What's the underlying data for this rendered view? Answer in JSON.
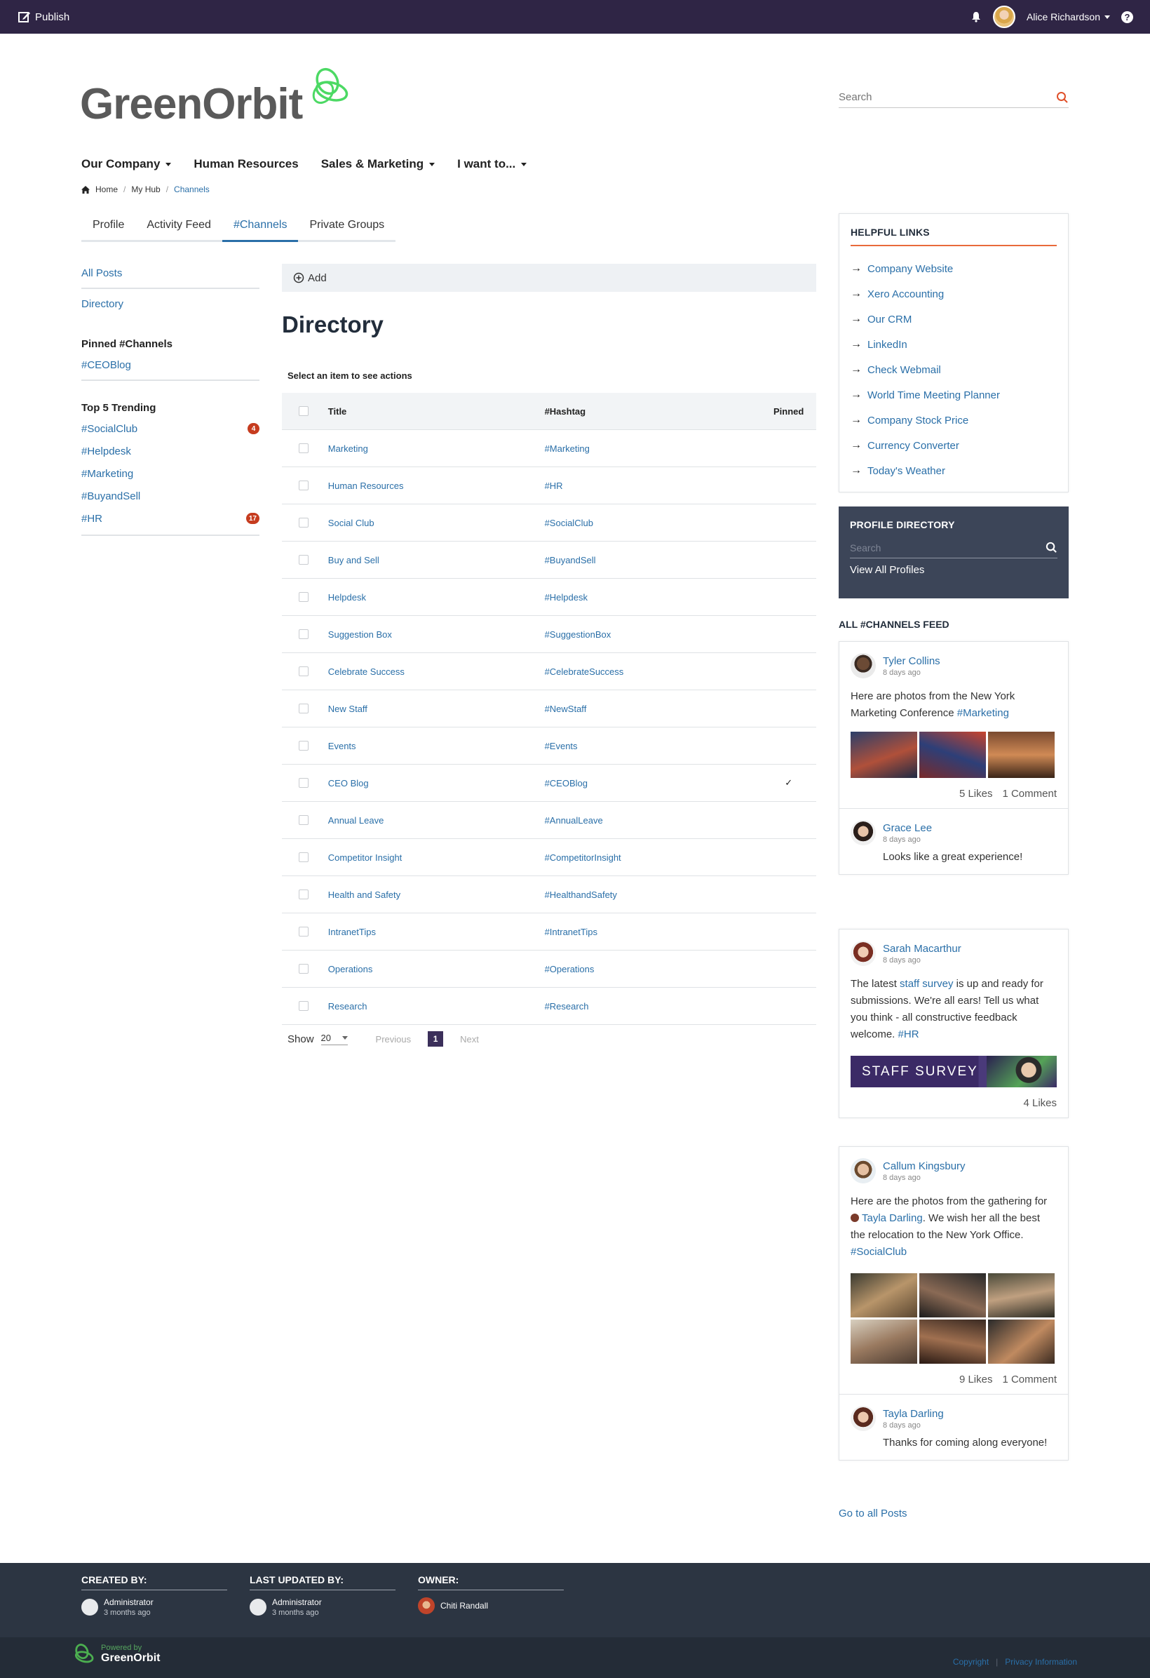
{
  "topbar": {
    "publish_label": "Publish",
    "user_name": "Alice Richardson",
    "help_label": "?"
  },
  "brand": {
    "logo_text": "GreenOrbit",
    "accent": "#4cd964",
    "nav_bg": "#2f2545"
  },
  "search": {
    "placeholder": "Search"
  },
  "nav": {
    "items": [
      {
        "label": "Our Company",
        "dropdown": true
      },
      {
        "label": "Human Resources",
        "dropdown": false
      },
      {
        "label": "Sales & Marketing",
        "dropdown": true
      },
      {
        "label": "I want to...",
        "dropdown": true
      }
    ]
  },
  "breadcrumb": {
    "home": "Home",
    "hub": "My Hub",
    "current": "Channels"
  },
  "tabs": [
    {
      "label": "Profile"
    },
    {
      "label": "Activity Feed"
    },
    {
      "label": "#Channels",
      "active": true
    },
    {
      "label": "Private Groups"
    }
  ],
  "leftnav": {
    "all_posts": "All Posts",
    "directory": "Directory",
    "pinned_heading": "Pinned #Channels",
    "pinned": [
      "#CEOBlog"
    ],
    "trending_heading": "Top 5 Trending",
    "trending": [
      {
        "label": "#SocialClub",
        "badge": "4"
      },
      {
        "label": "#Helpdesk",
        "badge": ""
      },
      {
        "label": "#Marketing",
        "badge": ""
      },
      {
        "label": "#BuyandSell",
        "badge": ""
      },
      {
        "label": "#HR",
        "badge": "17"
      }
    ]
  },
  "directory": {
    "add_label": "Add",
    "title": "Directory",
    "hint": "Select an item to see actions",
    "columns": {
      "title": "Title",
      "hashtag": "#Hashtag",
      "pinned": "Pinned"
    },
    "rows": [
      {
        "title": "Marketing",
        "hashtag": "#Marketing",
        "pinned": ""
      },
      {
        "title": "Human Resources",
        "hashtag": "#HR",
        "pinned": ""
      },
      {
        "title": "Social Club",
        "hashtag": "#SocialClub",
        "pinned": ""
      },
      {
        "title": "Buy and Sell",
        "hashtag": "#BuyandSell",
        "pinned": ""
      },
      {
        "title": "Helpdesk",
        "hashtag": "#Helpdesk",
        "pinned": ""
      },
      {
        "title": "Suggestion Box",
        "hashtag": "#SuggestionBox",
        "pinned": ""
      },
      {
        "title": "Celebrate Success",
        "hashtag": "#CelebrateSuccess",
        "pinned": ""
      },
      {
        "title": "New Staff",
        "hashtag": "#NewStaff",
        "pinned": ""
      },
      {
        "title": "Events",
        "hashtag": "#Events",
        "pinned": ""
      },
      {
        "title": "CEO Blog",
        "hashtag": "#CEOBlog",
        "pinned": "✓"
      },
      {
        "title": "Annual Leave",
        "hashtag": "#AnnualLeave",
        "pinned": ""
      },
      {
        "title": "Competitor Insight",
        "hashtag": "#CompetitorInsight",
        "pinned": ""
      },
      {
        "title": "Health and Safety",
        "hashtag": "#HealthandSafety",
        "pinned": ""
      },
      {
        "title": "IntranetTips",
        "hashtag": "#IntranetTips",
        "pinned": ""
      },
      {
        "title": "Operations",
        "hashtag": "#Operations",
        "pinned": ""
      },
      {
        "title": "Research",
        "hashtag": "#Research",
        "pinned": ""
      }
    ],
    "pager": {
      "show_label": "Show",
      "page_size": "20",
      "previous": "Previous",
      "current": "1",
      "next": "Next"
    }
  },
  "helpful_links": {
    "heading": "HELPFUL LINKS",
    "items": [
      "Company Website",
      "Xero Accounting",
      "Our CRM",
      "LinkedIn",
      "Check Webmail",
      "World Time Meeting Planner",
      "Company Stock Price",
      "Currency Converter",
      "Today's Weather"
    ]
  },
  "profile_directory": {
    "heading": "PROFILE DIRECTORY",
    "placeholder": "Search",
    "view_all": "View All Profiles"
  },
  "feed": {
    "heading": "ALL #CHANNELS FEED",
    "post1": {
      "author": "Tyler Collins",
      "time": "8 days ago",
      "text": "Here are photos from the New York Marketing Conference ",
      "tag": "#Marketing",
      "likes": "5 Likes",
      "comments": "1 Comment",
      "reply": {
        "author": "Grace Lee",
        "time": "8 days ago",
        "text": "Looks like a great experience!"
      }
    },
    "post2": {
      "author": "Sarah Macarthur",
      "time": "8 days ago",
      "text_a": "The latest ",
      "link": "staff survey",
      "text_b": " is up and ready for submissions. We're all ears! Tell us what you think - all constructive feedback welcome. ",
      "tag": "#HR",
      "banner": "STAFF SURVEY",
      "likes": "4 Likes"
    },
    "post3": {
      "author": "Callum Kingsbury",
      "time": "8 days ago",
      "text_a": "Here are the photos from the gathering for ",
      "mention": "Tayla Darling",
      "text_b": ". We wish her all the best the relocation to the New York Office. ",
      "tag": "#SocialClub",
      "likes": "9 Likes",
      "comments": "1 Comment",
      "reply": {
        "author": "Tayla Darling",
        "time": "8 days ago",
        "text": "Thanks for coming along everyone!"
      }
    },
    "goto": "Go to all Posts"
  },
  "footer": {
    "created_by": {
      "label": "CREATED BY:",
      "name": "Administrator",
      "time": "3 months ago"
    },
    "updated_by": {
      "label": "LAST UPDATED BY:",
      "name": "Administrator",
      "time": "3 months ago"
    },
    "owner": {
      "label": "OWNER:",
      "name": "Chiti Randall"
    },
    "powered_by": "Powered by",
    "powered_name": "GreenOrbit",
    "copyright": "Copyright",
    "privacy": "Privacy Information"
  }
}
